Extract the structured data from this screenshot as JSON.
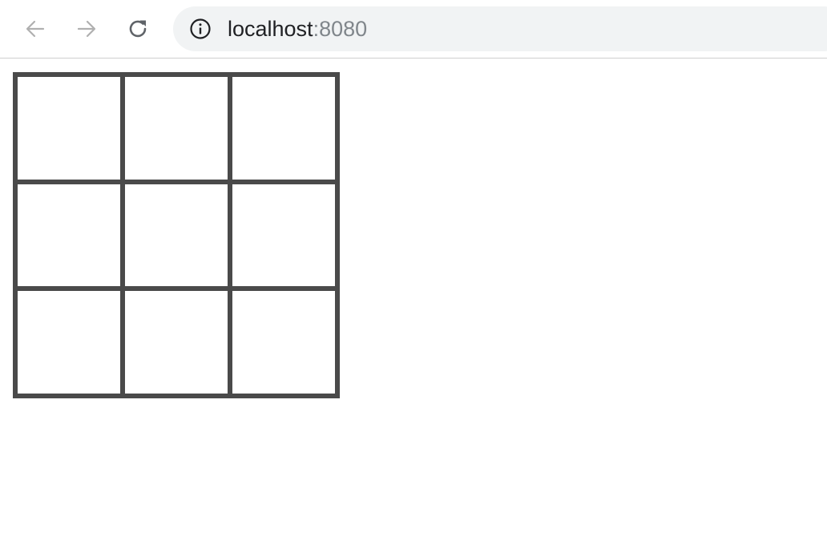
{
  "browser": {
    "back_icon": "arrow-left-icon",
    "forward_icon": "arrow-right-icon",
    "reload_icon": "reload-icon",
    "site_info_icon": "info-icon",
    "url_host": "localhost",
    "url_port": ":8080",
    "colors": {
      "omnibox_bg": "#f1f3f4",
      "disabled_icon": "#b0b0b0",
      "active_icon": "#5f6368",
      "url_text": "#202124",
      "url_port_text": "#80868b"
    }
  },
  "board": {
    "rows": 3,
    "cols": 3,
    "line_color": "#4a4a4a",
    "cells": [
      "",
      "",
      "",
      "",
      "",
      "",
      "",
      "",
      ""
    ]
  }
}
